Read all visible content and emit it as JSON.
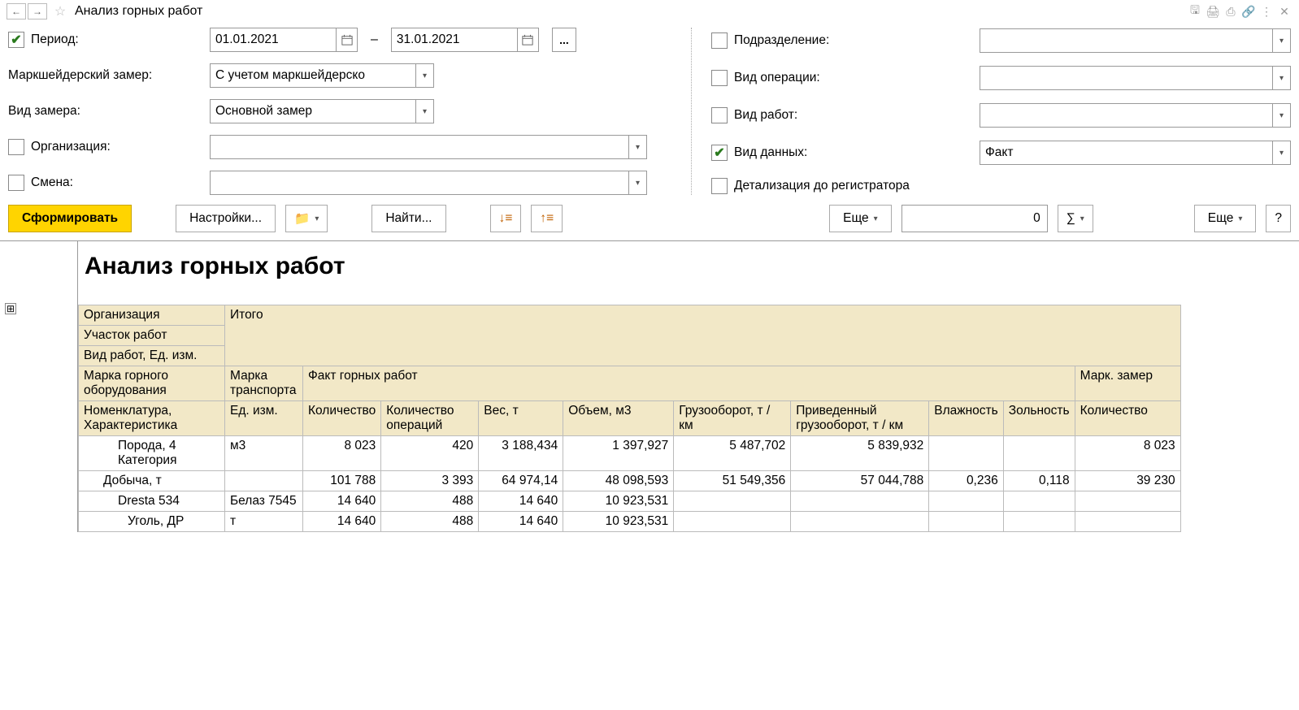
{
  "header": {
    "title": "Анализ горных работ"
  },
  "filters": {
    "period_label": "Период:",
    "period_from": "01.01.2021",
    "period_to": "31.01.2021",
    "dash": "–",
    "markscheider_label": "Маркшейдерский замер:",
    "markscheider_value": "С учетом маркшейдерско",
    "measure_type_label": "Вид замера:",
    "measure_type_value": "Основной замер",
    "organization_label": "Организация:",
    "organization_value": "",
    "shift_label": "Смена:",
    "shift_value": "",
    "subdivision_label": "Подразделение:",
    "subdivision_value": "",
    "operation_type_label": "Вид операции:",
    "operation_type_value": "",
    "work_type_label": "Вид работ:",
    "work_type_value": "",
    "data_type_label": "Вид данных:",
    "data_type_value": "Факт",
    "detail_label": "Детализация до регистратора"
  },
  "toolbar": {
    "generate": "Сформировать",
    "settings": "Настройки...",
    "find": "Найти...",
    "more1": "Еще",
    "number_value": "0",
    "sigma": "∑",
    "more2": "Еще",
    "help": "?"
  },
  "report": {
    "title": "Анализ горных работ",
    "headers": {
      "organization": "Организация",
      "total": "Итого",
      "work_site": "Участок работ",
      "work_type_unit": "Вид работ, Ед. изм.",
      "equipment_brand": "Марка горного оборудования",
      "transport_brand": "Марка транспорта",
      "fact_group": "Факт горных работ",
      "mark_group": "Марк. замер",
      "nomenclature": "Номенклатура, Характеристика",
      "unit": "Ед. изм.",
      "quantity": "Количество",
      "operations_count": "Количество операций",
      "weight": "Вес, т",
      "volume": "Объем, м3",
      "turnover": "Грузооборот, т / км",
      "reduced_turnover": "Приведенный грузооборот, т / км",
      "humidity": "Влажность",
      "ash": "Зольность",
      "mark_quantity": "Количество"
    },
    "rows": [
      {
        "name": "Порода, 4 Категория",
        "unit": "м3",
        "indent": 2,
        "qty": "8 023",
        "ops": "420",
        "weight": "3 188,434",
        "volume": "1 397,927",
        "turnover": "5 487,702",
        "reduced": "5 839,932",
        "humidity": "",
        "ash": "",
        "mark_qty": "8 023"
      },
      {
        "name": "Добыча, т",
        "unit": "",
        "indent": 1,
        "qty": "101 788",
        "ops": "3 393",
        "weight": "64 974,14",
        "volume": "48 098,593",
        "turnover": "51 549,356",
        "reduced": "57 044,788",
        "humidity": "0,236",
        "ash": "0,118",
        "mark_qty": "39 230"
      },
      {
        "name": "Dresta 534",
        "unit": "Белаз 7545",
        "indent": 2,
        "qty": "14 640",
        "ops": "488",
        "weight": "14 640",
        "volume": "10 923,531",
        "turnover": "",
        "reduced": "",
        "humidity": "",
        "ash": "",
        "mark_qty": ""
      },
      {
        "name": "Уголь, ДР",
        "unit": "т",
        "indent": 3,
        "qty": "14 640",
        "ops": "488",
        "weight": "14 640",
        "volume": "10 923,531",
        "turnover": "",
        "reduced": "",
        "humidity": "",
        "ash": "",
        "mark_qty": ""
      }
    ]
  }
}
